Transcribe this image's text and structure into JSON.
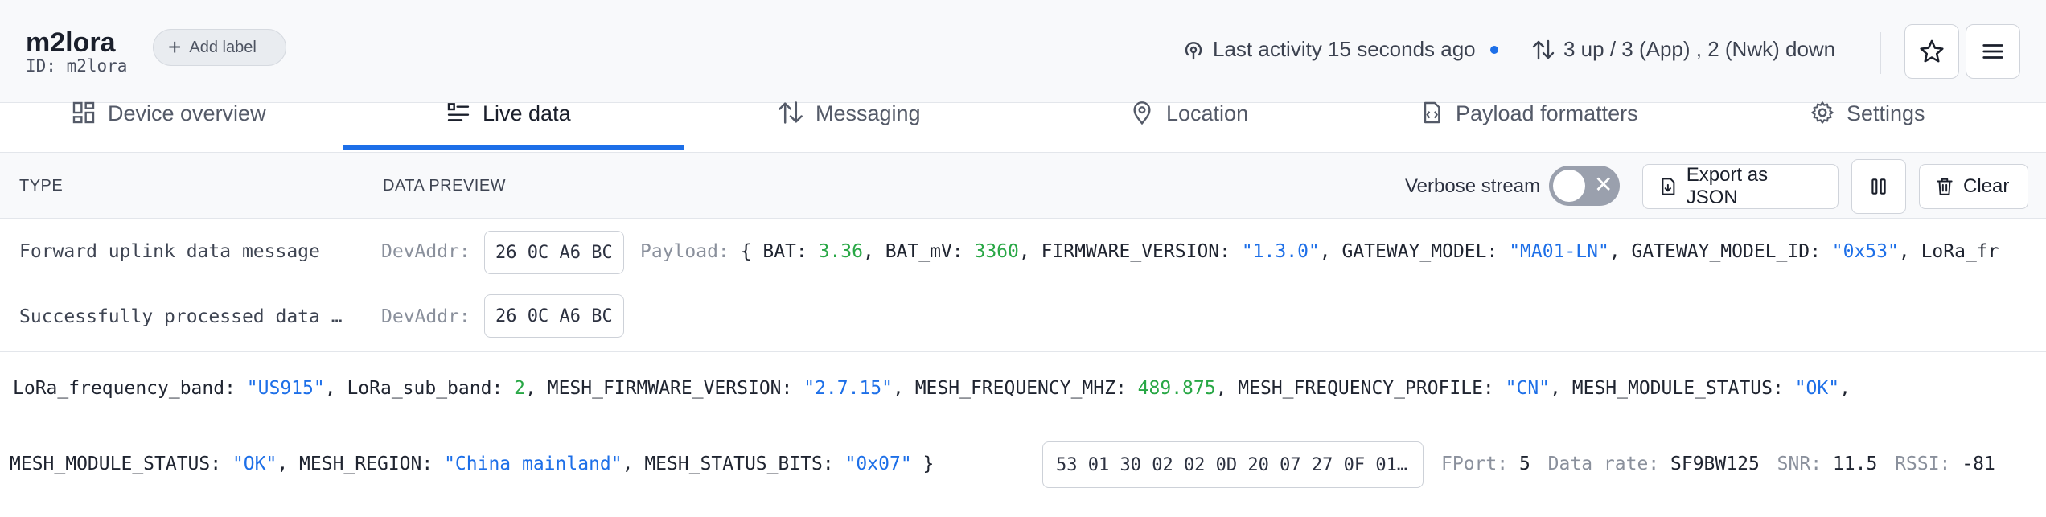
{
  "device": {
    "name": "m2lora",
    "id_text": "ID: m2lora",
    "add_label": "Add label"
  },
  "status": {
    "last_activity": "Last activity 15 seconds ago",
    "traffic": "3 up / 3 (App) , 2 (Nwk) down"
  },
  "tabs": [
    {
      "label": "Device overview"
    },
    {
      "label": "Live data"
    },
    {
      "label": "Messaging"
    },
    {
      "label": "Location"
    },
    {
      "label": "Payload formatters"
    },
    {
      "label": "Settings"
    }
  ],
  "table": {
    "col_type": "TYPE",
    "col_preview": "DATA PREVIEW",
    "verbose_label": "Verbose stream",
    "export_label": "Export as JSON",
    "clear_label": "Clear"
  },
  "events": [
    {
      "type": "Forward uplink data message",
      "devaddr_key": "DevAddr:",
      "devaddr": "26 0C A6 BC",
      "payload_key": "Payload:"
    },
    {
      "type": "Successfully processed data …",
      "devaddr_key": "DevAddr:",
      "devaddr": "26 0C A6 BC"
    }
  ],
  "payload": {
    "open": "{",
    "close": "}",
    "line1": [
      {
        "k": "BAT",
        "v": "3.36",
        "t": "num"
      },
      {
        "k": "BAT_mV",
        "v": "3360",
        "t": "num"
      },
      {
        "k": "FIRMWARE_VERSION",
        "v": "\"1.3.0\"",
        "t": "str"
      },
      {
        "k": "GATEWAY_MODEL",
        "v": "\"MA01-LN\"",
        "t": "str"
      },
      {
        "k": "GATEWAY_MODEL_ID",
        "v": "\"0x53\"",
        "t": "str"
      },
      {
        "k": "LoRa_fr",
        "v": "",
        "t": "cut"
      }
    ],
    "line2": [
      {
        "k": "LoRa_frequency_band",
        "v": "\"US915\"",
        "t": "str"
      },
      {
        "k": "LoRa_sub_band",
        "v": "2",
        "t": "num"
      },
      {
        "k": "MESH_FIRMWARE_VERSION",
        "v": "\"2.7.15\"",
        "t": "str"
      },
      {
        "k": "MESH_FREQUENCY_MHZ",
        "v": "489.875",
        "t": "num"
      },
      {
        "k": "MESH_FREQUENCY_PROFILE",
        "v": "\"CN\"",
        "t": "str"
      },
      {
        "k": "MESH_MODULE_STATUS",
        "v": "\"OK\"",
        "t": "str"
      }
    ],
    "line3": [
      {
        "k": "MESH_MODULE_STATUS",
        "v": "\"OK\"",
        "t": "str"
      },
      {
        "k": "MESH_REGION",
        "v": "\"China mainland\"",
        "t": "str"
      },
      {
        "k": "MESH_STATUS_BITS",
        "v": "\"0x07\"",
        "t": "str"
      }
    ],
    "raw_hex": "53 01 30 02 02 0D 20 07 27 0F 01…",
    "fport_key": "FPort:",
    "fport": "5",
    "datarate_key": "Data rate:",
    "datarate": "SF9BW125",
    "snr_key": "SNR:",
    "snr": "11.5",
    "rssi_key": "RSSI:",
    "rssi": "-81"
  },
  "colors": {
    "accent": "#1d6fe8",
    "number": "#28a745",
    "string": "#1d6fe8"
  }
}
